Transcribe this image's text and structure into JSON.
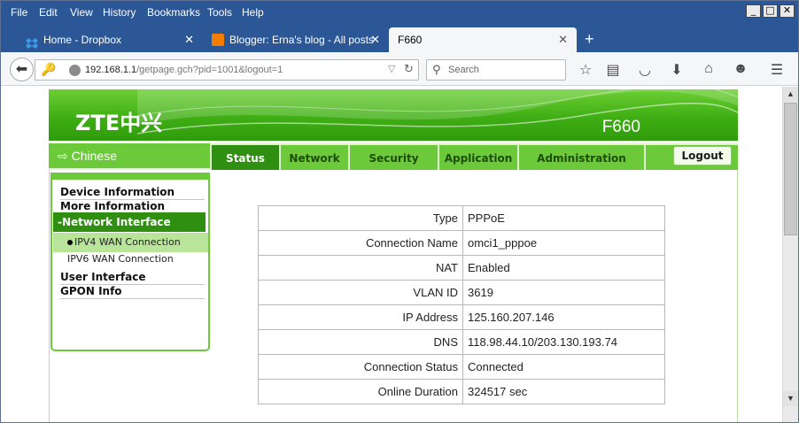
{
  "menu": [
    "File",
    "Edit",
    "View",
    "History",
    "Bookmarks",
    "Tools",
    "Help"
  ],
  "window_buttons": {
    "minimize": "_",
    "maximize": "□",
    "close": "✕"
  },
  "tabs": [
    {
      "label": "Home - Dropbox",
      "icon": "dropbox-icon"
    },
    {
      "label": "Blogger: Erna's blog - All posts",
      "icon": "blogger-icon"
    },
    {
      "label": "F660",
      "active": true
    }
  ],
  "url": {
    "host": "192.168.1.1",
    "path": "/getpage.gch?pid=1001&logout=1"
  },
  "search_placeholder": "Search",
  "router": {
    "brand": "ZTE中兴",
    "model": "F660",
    "language_link": "Chinese",
    "nav": [
      "Status",
      "Network",
      "Security",
      "Application",
      "Administration"
    ],
    "active_nav": "Status",
    "logout": "Logout"
  },
  "sidebar": {
    "device_info": "Device Information",
    "more_info": "More Information",
    "network_interface": "-Network Interface",
    "ipv4_wan": "IPV4 WAN Connection",
    "ipv6_wan": "IPV6 WAN Connection",
    "user_interface": "User Interface",
    "gpon_info": "GPON Info"
  },
  "info": [
    {
      "key": "Type",
      "value": "PPPoE"
    },
    {
      "key": "Connection Name",
      "value": "omci1_pppoe"
    },
    {
      "key": "NAT",
      "value": "Enabled"
    },
    {
      "key": "VLAN ID",
      "value": "3619"
    },
    {
      "key": "IP Address",
      "value": "125.160.207.146"
    },
    {
      "key": "DNS",
      "value": "118.98.44.10/203.130.193.74"
    },
    {
      "key": "Connection Status",
      "value": "Connected"
    },
    {
      "key": "Online Duration",
      "value": "324517 sec"
    }
  ],
  "colors": {
    "zte_green": "#3fae14",
    "nav_active": "#2f8f10",
    "titlebar": "#2b5797"
  }
}
